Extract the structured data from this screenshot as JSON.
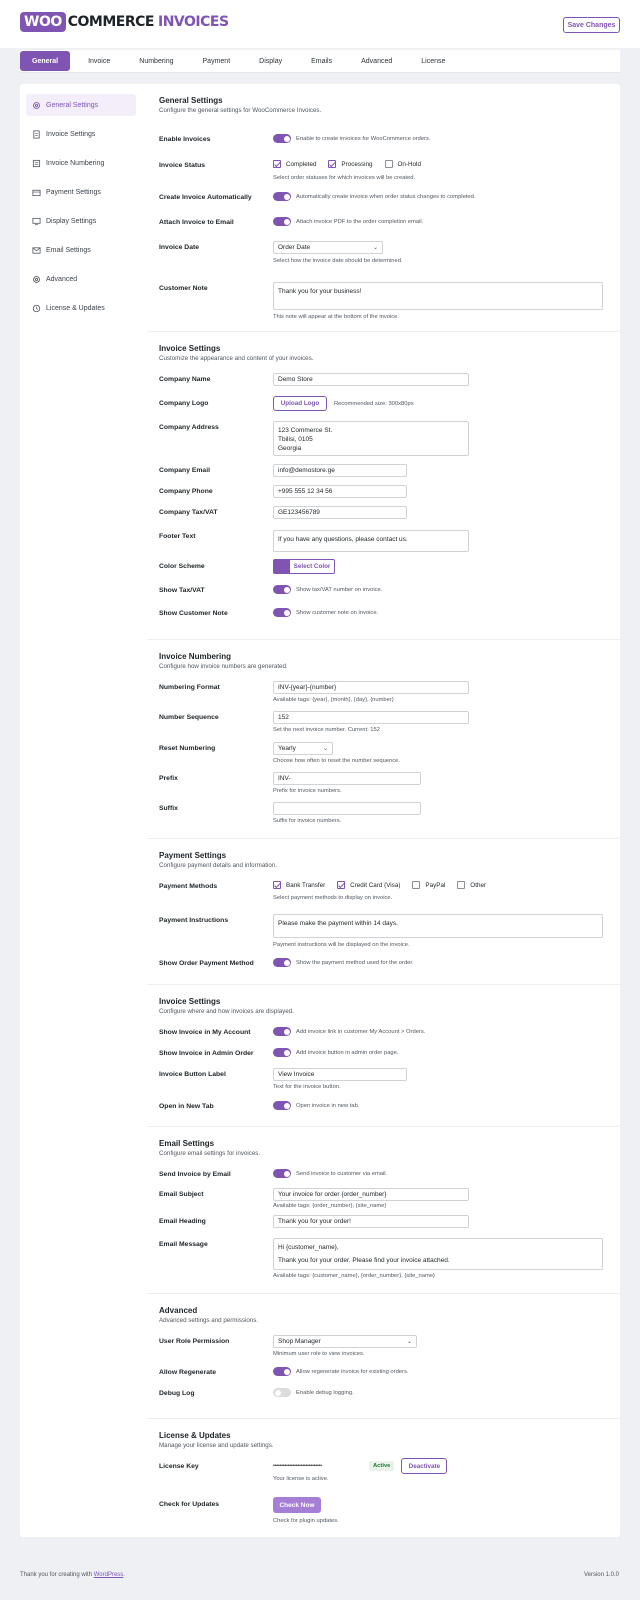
{
  "header": {
    "logo_woo": "WOO",
    "logo_commerce": "COMMERCE",
    "logo_invoices": "INVOICES",
    "save_label": "Save Changes"
  },
  "tabs": [
    {
      "label": "General"
    },
    {
      "label": "Invoice"
    },
    {
      "label": "Numbering"
    },
    {
      "label": "Payment"
    },
    {
      "label": "Display"
    },
    {
      "label": "Emails"
    },
    {
      "label": "Advanced"
    },
    {
      "label": "License"
    }
  ],
  "sidebar": {
    "items": [
      {
        "label": "General Settings",
        "icon": "gear-icon"
      },
      {
        "label": "Invoice Settings",
        "icon": "document-icon"
      },
      {
        "label": "Invoice Numbering",
        "icon": "list-icon"
      },
      {
        "label": "Payment Settings",
        "icon": "wallet-icon"
      },
      {
        "label": "Display Settings",
        "icon": "monitor-icon"
      },
      {
        "label": "Email Settings",
        "icon": "mail-icon"
      },
      {
        "label": "Advanced",
        "icon": "cog-icon"
      },
      {
        "label": "License & Updates",
        "icon": "clock-icon"
      }
    ]
  },
  "general": {
    "title": "General Settings",
    "desc": "Configure the general settings for WooCommerce Invoices.",
    "enable_label": "Enable Invoices",
    "enable_text": "Enable to create invoices for WooCommerce orders.",
    "status_label": "Invoice Status",
    "status_options": [
      "Completed",
      "Processing",
      "On-Hold"
    ],
    "status_help": "Select order statuses for which invoices will be created.",
    "auto_label": "Create Invoice Automatically",
    "auto_text": "Automatically create invoice when order status changes to completed.",
    "attach_label": "Attach Invoice to Email",
    "attach_text": "Attach invoice PDF to the order completion email.",
    "date_label": "Invoice Date",
    "date_value": "Order Date",
    "date_help": "Select how the invoice date should be determined.",
    "note_label": "Customer Note",
    "note_value": "Thank you for your business!",
    "note_help": "This note will appear at the bottom of the invoice."
  },
  "invoice": {
    "title": "Invoice Settings",
    "desc": "Customize the appearance and content of your invoices.",
    "company_name_label": "Company Name",
    "company_name": "Demo Store",
    "logo_label": "Company Logo",
    "upload_label": "Upload Logo",
    "logo_help": "Recommended size: 300x80px",
    "address_label": "Company Address",
    "address_lines": [
      "123 Commerce St.",
      "Tbilisi, 0105",
      "Georgia"
    ],
    "email_label": "Company Email",
    "email": "info@demostore.ge",
    "phone_label": "Company Phone",
    "phone": "+995 555 12 34 56",
    "tax_label": "Company Tax/VAT",
    "tax": "GE123456789",
    "footer_label": "Footer Text",
    "footer_value": "If you have any questions, please contact us.",
    "color_label": "Color Scheme",
    "color_value": "#7f54b3",
    "color_btn": "Select Color",
    "showtax_label": "Show Tax/VAT",
    "showtax_text": "Show tax/VAT number on invoice.",
    "shownote_label": "Show Customer Note",
    "shownote_text": "Show customer note on invoice."
  },
  "numbering": {
    "title": "Invoice Numbering",
    "desc": "Configure how invoice numbers are generated.",
    "format_label": "Numbering Format",
    "format_value": "INV-{year}-{number}",
    "format_help": "Available tags: {year}, {month}, {day}, {number}",
    "seq_label": "Number Sequence",
    "seq_value": "152",
    "seq_help": "Set the next invoice number. Current: 152",
    "reset_label": "Reset Numbering",
    "reset_value": "Yearly",
    "reset_help": "Choose how often to reset the number sequence.",
    "prefix_label": "Prefix",
    "prefix_value": "INV-",
    "prefix_help": "Prefix for invoice numbers.",
    "suffix_label": "Suffix",
    "suffix_value": "",
    "suffix_help": "Suffix for invoice numbers."
  },
  "payment": {
    "title": "Payment Settings",
    "desc": "Configure payment details and information.",
    "methods_label": "Payment Methods",
    "methods": [
      "Bank Transfer",
      "Credit Card (Visa)",
      "PayPal",
      "Other"
    ],
    "methods_help": "Select payment methods to display on invoice.",
    "instr_label": "Payment Instructions",
    "instr_value": "Please make the payment within 14 days.",
    "instr_help": "Payment instructions will be displayed on the invoice.",
    "showpm_label": "Show Order Payment Method",
    "showpm_text": "Show the payment method used for the order."
  },
  "display": {
    "title": "Invoice Settings",
    "desc": "Configure where and how invoices are displayed.",
    "myacc_label": "Show Invoice in My Account",
    "myacc_text": "Add invoice link in customer My Account > Orders.",
    "admin_label": "Show Invoice in Admin Order",
    "admin_text": "Add invoice button in admin order page.",
    "btnlabel_label": "Invoice Button Label",
    "btnlabel_value": "View Invoice",
    "btnlabel_help": "Text for the invoice button.",
    "newtab_label": "Open in New Tab",
    "newtab_text": "Open invoice in new tab."
  },
  "email": {
    "title": "Email Settings",
    "desc": "Configure email settings for invoices.",
    "send_label": "Send Invoice by Email",
    "send_text": "Send invoice to customer via email.",
    "subject_label": "Email Subject",
    "subject_value": "Your invoice for order {order_number}",
    "subject_help": "Available tags: {order_number}, {site_name}",
    "heading_label": "Email Heading",
    "heading_value": "Thank you for your order!",
    "message_label": "Email Message",
    "message_line1": "Hi {customer_name},",
    "message_line2": "Thank you for your order. Please find your invoice attached.",
    "message_help": "Available tags: {customer_name}, {order_number}, {site_name}"
  },
  "advanced": {
    "title": "Advanced",
    "desc": "Advanced settings and permissions.",
    "role_label": "User Role Permission",
    "role_value": "Shop Manager",
    "role_help": "Minimum user role to view invoices.",
    "regen_label": "Allow Regenerate",
    "regen_text": "Allow regenerate invoice for existing orders.",
    "debug_label": "Debug Log",
    "debug_text": "Enable debug logging."
  },
  "license": {
    "title": "License & Updates",
    "desc": "Manage your license and update settings.",
    "key_label": "License Key",
    "key_value": "••••••••••••••••••••••••••••••",
    "badge": "Active",
    "deactivate": "Deactivate",
    "key_help": "Your license is active.",
    "check_label": "Check for Updates",
    "check_btn": "Check Now",
    "check_help": "Check for plugin updates."
  },
  "footer": {
    "thanks": "Thank you for creating with",
    "wp": "WordPress",
    "version": "Version 1.0.0"
  }
}
